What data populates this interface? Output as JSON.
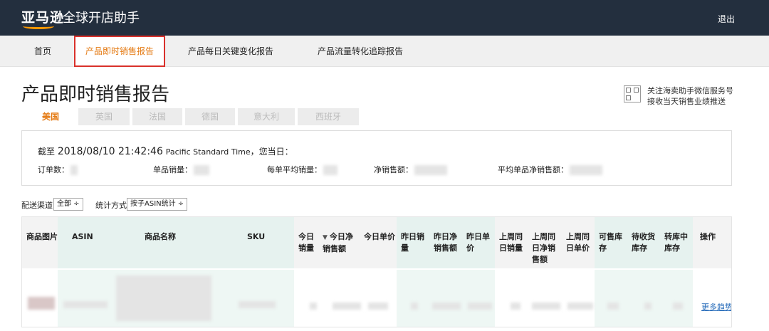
{
  "header": {
    "logo_text": "亚马逊",
    "logo_suffix": "全球开店助手",
    "logout": "退出"
  },
  "nav": [
    {
      "label": "首页",
      "active": false
    },
    {
      "label": "产品即时销售报告",
      "active": true
    },
    {
      "label": "产品每日关键变化报告",
      "active": false
    },
    {
      "label": "产品流量转化追踪报告",
      "active": false
    }
  ],
  "page": {
    "title": "产品即时销售报告"
  },
  "wechat": {
    "line1": "关注海卖助手微信服务号",
    "line2": "接收当天销售业绩推送"
  },
  "country_tabs": [
    {
      "label": "美国",
      "active": true
    },
    {
      "label": "英国",
      "active": false
    },
    {
      "label": "法国",
      "active": false
    },
    {
      "label": "德国",
      "active": false
    },
    {
      "label": "意大利",
      "active": false
    },
    {
      "label": "西班牙",
      "active": false
    }
  ],
  "summary": {
    "prefix": "截至",
    "timestamp": "2018/08/10 21:42:46",
    "timezone": "Pacific Standard Time",
    "suffix": "，您当日：",
    "metrics": [
      {
        "label": "订单数：",
        "value": ""
      },
      {
        "label": "单品销量：",
        "value": ""
      },
      {
        "label": "每单平均销量：",
        "value": ""
      },
      {
        "label": "净销售额：",
        "value": ""
      },
      {
        "label": "平均单品净销售额：",
        "value": ""
      }
    ]
  },
  "filters": {
    "channel_label": "配送渠道",
    "channel_value": "全部 ÷",
    "method_label": "统计方式",
    "method_value": "按子ASIN统计 ÷"
  },
  "table": {
    "columns": [
      {
        "label": "商品图片"
      },
      {
        "label": "ASIN"
      },
      {
        "label": "商品名称"
      },
      {
        "label": "SKU"
      },
      {
        "label": "今日销量"
      },
      {
        "label": "今日净销售额"
      },
      {
        "label": "今日单价"
      },
      {
        "label": "昨日销量"
      },
      {
        "label": "昨日净销售额"
      },
      {
        "label": "昨日单价"
      },
      {
        "label": "上周同日销量"
      },
      {
        "label": "上周同日净销售额"
      },
      {
        "label": "上周同日单价"
      },
      {
        "label": "可售库存"
      },
      {
        "label": "待收货库存"
      },
      {
        "label": "转库中库存"
      },
      {
        "label": "操作"
      }
    ],
    "sort_glyph": "▼",
    "row_action": "更多趋势"
  },
  "colors": {
    "topbar": "#232f3e",
    "accent": "#e47911",
    "highlight_border": "#d9312b",
    "link": "#2a6ebb"
  }
}
